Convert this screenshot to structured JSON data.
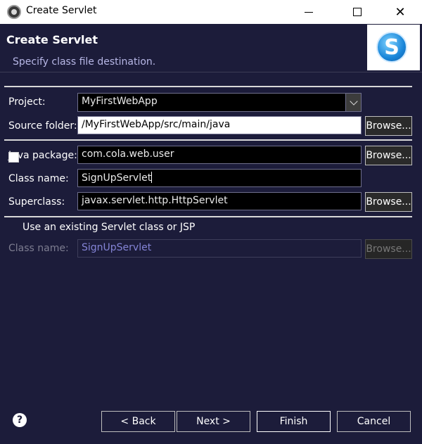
{
  "window": {
    "title": "Create Servlet",
    "controls": {
      "minimize": "minimize-icon",
      "maximize": "maximize-icon",
      "close": "✕"
    }
  },
  "banner": {
    "title": "Create Servlet",
    "description": "Specify class file destination.",
    "logo_letter": "S"
  },
  "form": {
    "project": {
      "label": "Project:",
      "value": "MyFirstWebApp"
    },
    "source_folder": {
      "label": "Source folder:",
      "value": "/MyFirstWebApp/src/main/java",
      "browse": "Browse..."
    },
    "java_package": {
      "label": "Java package:",
      "value": "com.cola.web.user",
      "browse": "Browse..."
    },
    "class_name": {
      "label": "Class name:",
      "value": "SignUpServlet"
    },
    "superclass": {
      "label": "Superclass:",
      "value": "javax.servlet.http.HttpServlet",
      "browse": "Browse..."
    },
    "existing_servlet": {
      "label": "Use an existing Servlet class or JSP",
      "checked": false
    },
    "existing_class_name": {
      "label": "Class name:",
      "value": "SignUpServlet",
      "browse": "Browse..."
    }
  },
  "footer": {
    "help": "?",
    "back": "< Back",
    "next": "Next >",
    "finish": "Finish",
    "cancel": "Cancel"
  },
  "colors": {
    "panel_bg": "#1c1c3a",
    "disabled_text": "#8484d6"
  }
}
